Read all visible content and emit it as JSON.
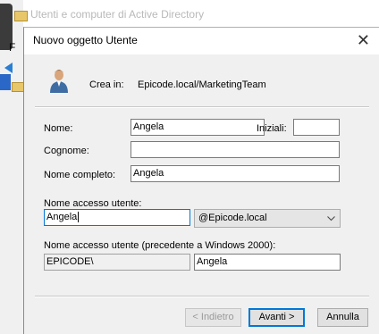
{
  "background_window": {
    "title": "Utenti e computer di Active Directory",
    "letter": "F"
  },
  "dialog": {
    "title": "Nuovo oggetto Utente",
    "close_glyph": "✕",
    "create_in_label": "Crea in:",
    "create_in_path": "Epicode.local/MarketingTeam"
  },
  "form": {
    "first_name_label": "Nome:",
    "first_name_value": "Angela",
    "initials_label": "Iniziali:",
    "initials_value": "",
    "last_name_label": "Cognome:",
    "last_name_value": "",
    "full_name_label": "Nome completo:",
    "full_name_value": "Angela",
    "logon_name_label": "Nome accesso utente:",
    "logon_name_value": "Angela",
    "domain_suffix_value": "@Epicode.local",
    "legacy_logon_label": "Nome accesso utente (precedente a Windows 2000):",
    "legacy_domain_value": "EPICODE\\",
    "legacy_logon_value": "Angela"
  },
  "buttons": {
    "back_label": "< Indietro",
    "next_label": "Avanti >",
    "cancel_label": "Annulla"
  },
  "icons": {
    "user": "user-icon",
    "dropdown": "chevron-down-icon"
  },
  "colors": {
    "focus_border": "#0078d7",
    "dialog_bg": "#f0f0f0"
  }
}
